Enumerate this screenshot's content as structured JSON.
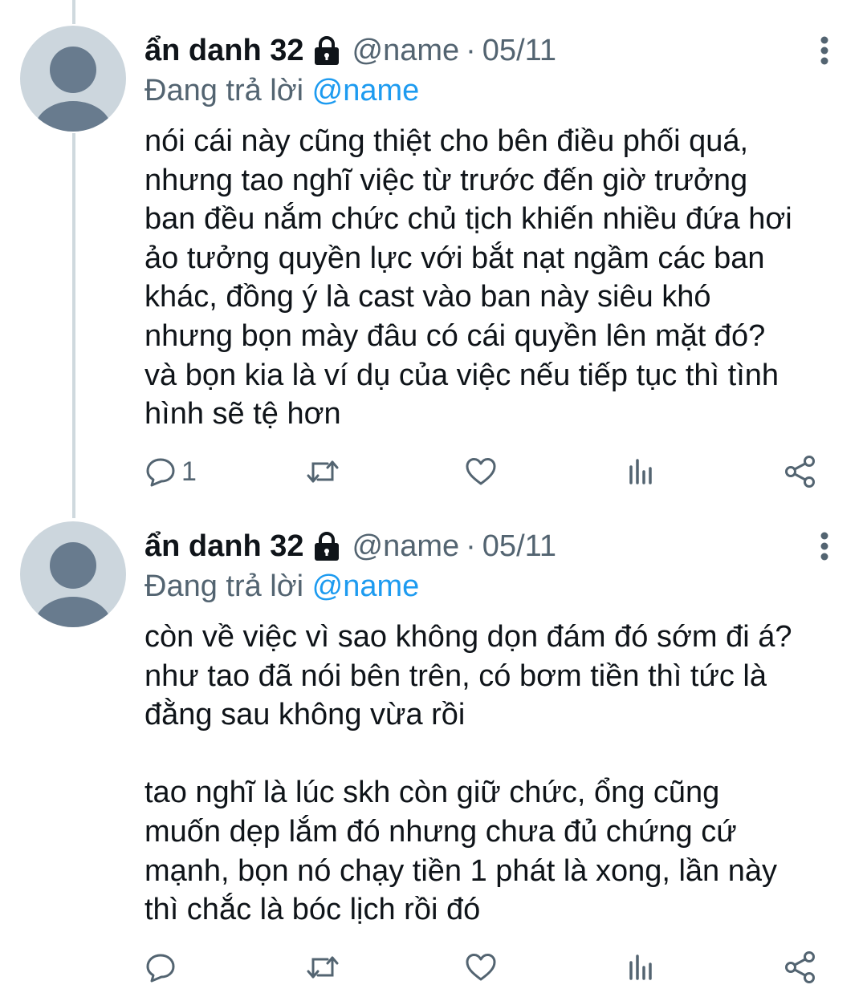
{
  "tweets": [
    {
      "display_name": "ẩn danh 32",
      "handle": "@name",
      "separator": "·",
      "date": "05/11",
      "reply_prefix": "Đang trả lời",
      "reply_to": "@name",
      "lines": [
        "nói cái này cũng thiệt cho bên điều phối quá,",
        "nhưng tao nghĩ việc từ trước đến giờ trưởng",
        "ban đều nắm chức chủ tịch khiến nhiều đứa hơi",
        "ảo tưởng quyền lực với bắt nạt ngầm các ban",
        "khác, đồng ý là cast vào ban này siêu khó",
        "nhưng bọn mày đâu có cái quyền lên mặt đó?",
        "và bọn kia là ví dụ của việc nếu tiếp tục thì tình",
        "hình sẽ tệ hơn"
      ],
      "reply_count": "1",
      "icons": {
        "locked": "lock-icon",
        "more": "more-options-icon",
        "reply": "reply-icon",
        "retweet": "retweet-icon",
        "like": "heart-icon",
        "views": "analytics-icon",
        "share": "share-icon"
      }
    },
    {
      "display_name": "ẩn danh 32",
      "handle": "@name",
      "separator": "·",
      "date": "05/11",
      "reply_prefix": "Đang trả lời",
      "reply_to": "@name",
      "lines": [
        "còn về việc vì sao không dọn đám đó sớm đi á?",
        "như tao đã nói bên trên, có bơm tiền thì tức là",
        "đằng sau không vừa rồi",
        "",
        "tao nghĩ là lúc skh còn giữ chức, ổng cũng",
        "muốn dẹp lắm đó nhưng chưa đủ chứng cứ",
        "mạnh, bọn nó chạy tiền 1 phát là xong, lần này",
        "thì chắc là bóc lịch rồi đó"
      ],
      "reply_count": "",
      "icons": {
        "locked": "lock-icon",
        "more": "more-options-icon",
        "reply": "reply-icon",
        "retweet": "retweet-icon",
        "like": "heart-icon",
        "views": "analytics-icon",
        "share": "share-icon"
      }
    }
  ],
  "colors": {
    "text_primary": "#0f1419",
    "text_secondary": "#536471",
    "link": "#1d9bf0",
    "avatar_bg": "#ccd6dd",
    "avatar_fg": "#687b8e",
    "thread_line": "#cfd9de"
  }
}
